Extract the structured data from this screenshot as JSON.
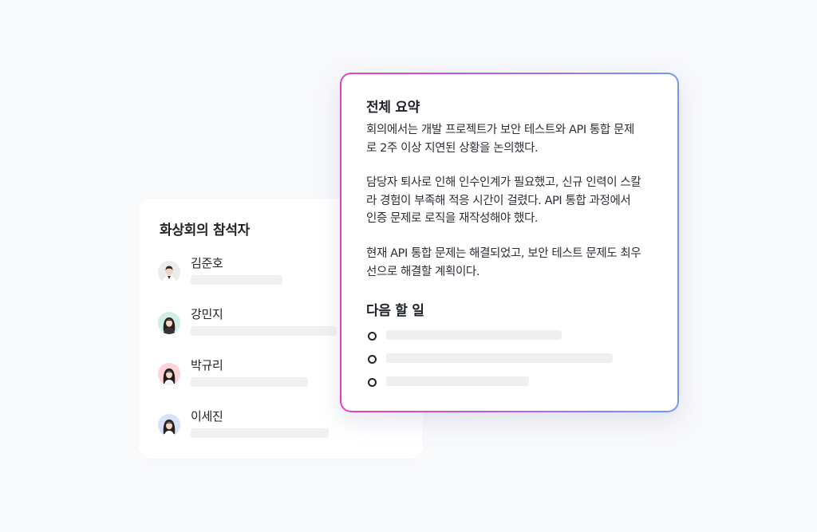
{
  "participants": {
    "title": "화상회의 참석자",
    "people": [
      {
        "name": "김준호",
        "avatar_icon": "man-avatar-icon",
        "avatar_bg": "#ececec"
      },
      {
        "name": "강민지",
        "avatar_icon": "woman-avatar-icon",
        "avatar_bg": "#cfeee6"
      },
      {
        "name": "박규리",
        "avatar_icon": "woman-avatar-icon",
        "avatar_bg": "#fbd3d8"
      },
      {
        "name": "이세진",
        "avatar_icon": "woman-avatar-icon",
        "avatar_bg": "#d6e3fb"
      }
    ]
  },
  "summary": {
    "title": "전체 요약",
    "paragraphs": [
      "회의에서는 개발 프로젝트가 보안 테스트와 API 통합 문제로 2주 이상 지연된 상황을 논의했다.",
      "담당자 퇴사로 인해 인수인계가 필요했고, 신규 인력이 스칼라 경험이 부족해 적응 시간이 걸렸다. API 통합 과정에서 인증 문제로 로직을 재작성해야 했다.",
      "현재 API 통합 문제는 해결되었고, 보안 테스트 문제도 최우선으로 해결할 계획이다."
    ],
    "border_gradient": [
      "#e63ec6",
      "#b065e6",
      "#6f9af2"
    ]
  },
  "next_steps": {
    "title": "다음 할 일",
    "bullet_icon": "circle-bullet-icon"
  }
}
